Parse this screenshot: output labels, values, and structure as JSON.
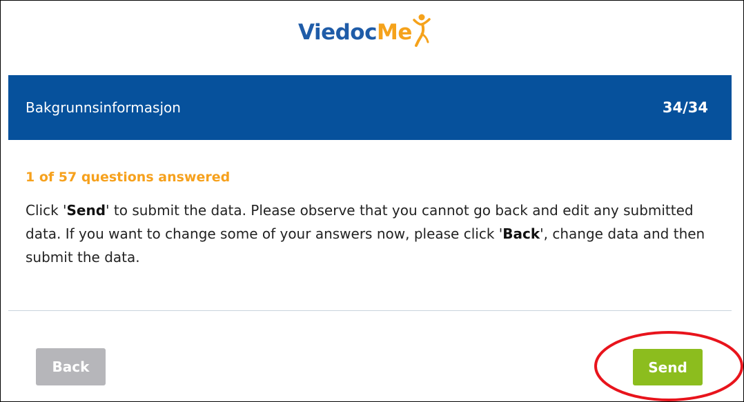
{
  "logo": {
    "part1": "Viedoc",
    "part2": "Me",
    "figure_icon": "person-jumping-icon"
  },
  "header": {
    "title": "Bakgrunnsinformasjon",
    "count": "34/34"
  },
  "progress": {
    "text": "1 of 57 questions answered"
  },
  "instructions": {
    "p1": "Click '",
    "send_word": "Send",
    "p2": "' to submit the data. Please observe that you cannot go back and edit any submitted data. If you want to change some of your answers now, please click '",
    "back_word": "Back",
    "p3": "', change data and then submit the data."
  },
  "buttons": {
    "back_label": "Back",
    "send_label": "Send"
  },
  "colors": {
    "header_bg": "#06519c",
    "accent_orange": "#f6a11d",
    "send_green": "#8cbd1e",
    "back_grey": "#b6b6ba",
    "annotation_red": "#e8141c"
  }
}
